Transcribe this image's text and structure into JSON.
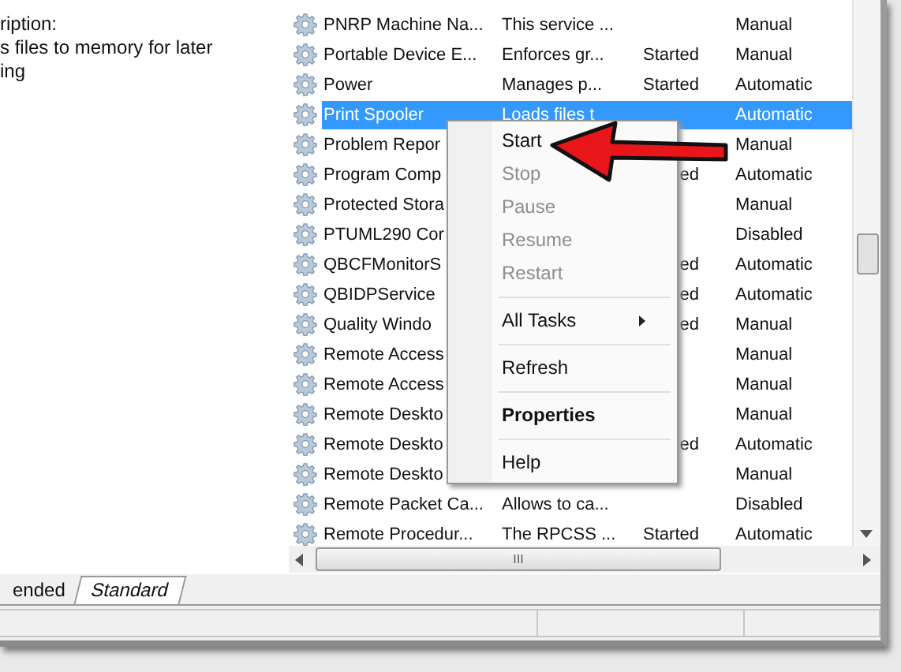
{
  "description_pane": {
    "lines": [
      "ription:",
      "s files to memory for later",
      "ing"
    ]
  },
  "services": [
    {
      "name": "PNRP Machine Na...",
      "description": "This service ...",
      "startup": "Manual",
      "selected": false
    },
    {
      "name": "Portable Device E...",
      "description": "Enforces gr...",
      "status": "Started",
      "startup": "Manual",
      "selected": false
    },
    {
      "name": "Power",
      "description": "Manages p...",
      "status": "Started",
      "startup": "Automatic",
      "selected": false
    },
    {
      "name": "Print Spooler",
      "description": "Loads files t",
      "startup": "Automatic",
      "selected": true
    },
    {
      "name": "Problem Repor",
      "startup": "Manual",
      "selected": false
    },
    {
      "name": "Program Comp",
      "status": "ed",
      "startup": "Automatic",
      "selected": false
    },
    {
      "name": "Protected Stora",
      "startup": "Manual",
      "selected": false
    },
    {
      "name": "PTUML290 Cor",
      "startup": "Disabled",
      "selected": false
    },
    {
      "name": "QBCFMonitorS",
      "status": "ed",
      "startup": "Automatic",
      "selected": false
    },
    {
      "name": "QBIDPService",
      "status": "ed",
      "startup": "Automatic",
      "selected": false
    },
    {
      "name": "Quality Windo",
      "status": "ed",
      "startup": "Manual",
      "selected": false
    },
    {
      "name": "Remote Access",
      "startup": "Manual",
      "selected": false
    },
    {
      "name": "Remote Access",
      "startup": "Manual",
      "selected": false
    },
    {
      "name": "Remote Deskto",
      "startup": "Manual",
      "selected": false
    },
    {
      "name": "Remote Deskto",
      "status": "ed",
      "startup": "Automatic",
      "selected": false
    },
    {
      "name": "Remote Deskto",
      "startup": "Manual",
      "selected": false
    },
    {
      "name": "Remote Packet Ca...",
      "description": "Allows to ca...",
      "startup": "Disabled",
      "selected": false
    },
    {
      "name": "Remote Procedur...",
      "description": "The RPCSS ...",
      "status": "Started",
      "startup": "Automatic",
      "selected": false
    }
  ],
  "context_menu": [
    {
      "kind": "item",
      "label": "Start",
      "disabled": false,
      "bold": false
    },
    {
      "kind": "item",
      "label": "Stop",
      "disabled": true,
      "bold": false
    },
    {
      "kind": "item",
      "label": "Pause",
      "disabled": true,
      "bold": false
    },
    {
      "kind": "item",
      "label": "Resume",
      "disabled": true,
      "bold": false
    },
    {
      "kind": "item",
      "label": "Restart",
      "disabled": true,
      "bold": false
    },
    {
      "kind": "separator"
    },
    {
      "kind": "submenu",
      "label": "All Tasks",
      "disabled": false,
      "bold": false
    },
    {
      "kind": "separator"
    },
    {
      "kind": "item",
      "label": "Refresh",
      "disabled": false,
      "bold": false
    },
    {
      "kind": "separator"
    },
    {
      "kind": "item",
      "label": "Properties",
      "disabled": false,
      "bold": true
    },
    {
      "kind": "separator"
    },
    {
      "kind": "item",
      "label": "Help",
      "disabled": false,
      "bold": false
    }
  ],
  "tabs": [
    {
      "label": "ended",
      "selected": false
    },
    {
      "label": "Standard",
      "selected": true
    }
  ],
  "horizontal_scrollbar": {
    "grip": "III"
  }
}
